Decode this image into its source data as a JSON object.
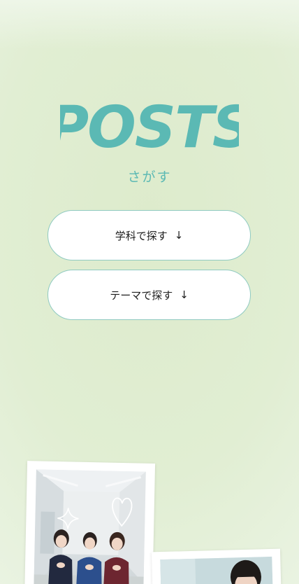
{
  "header": {
    "logo_text": "POSTS",
    "subtitle": "さがす"
  },
  "buttons": [
    {
      "label": "学科で探す",
      "arrow": "↓"
    },
    {
      "label": "テーマで探す",
      "arrow": "↓"
    }
  ],
  "colors": {
    "accent": "#5bb9b4",
    "background": "#e1eed3",
    "button_border": "#8fcac1",
    "button_bg": "#ffffff"
  },
  "icons": [
    "sparkle-icon",
    "heart-doodle-icon",
    "down-arrow-icon"
  ]
}
